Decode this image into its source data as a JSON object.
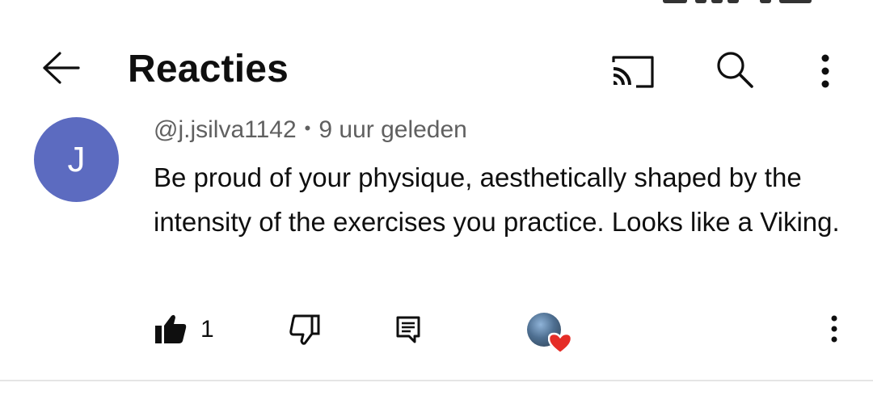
{
  "header": {
    "title": "Reacties",
    "icons": [
      "arrow-back-icon",
      "cast-icon",
      "search-icon",
      "more-vert-icon"
    ]
  },
  "comment": {
    "avatar_letter": "J",
    "avatar_color": "#5c6bc0",
    "author": "@j.jsilva1142",
    "separator": "•",
    "time": "9 uur geleden",
    "text": "Be proud of your physique, aesthetically shaped by the intensity of the exercises you practice. Looks like a Viking.",
    "like_count": "1",
    "creator_heart_color": "#e52d27"
  }
}
